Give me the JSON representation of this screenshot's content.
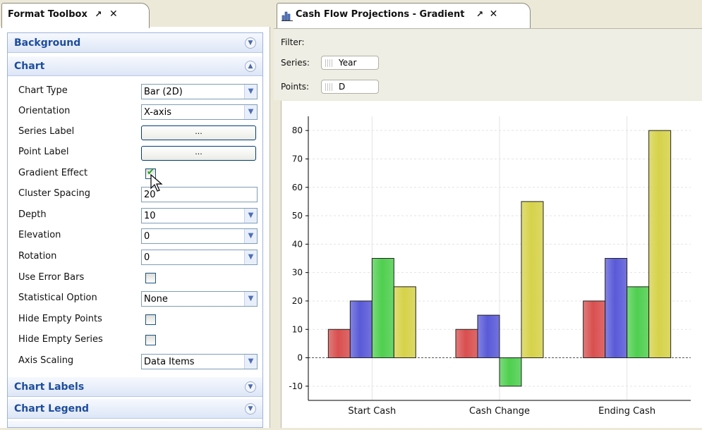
{
  "toolbox": {
    "tab_title": "Format Toolbox",
    "sections": {
      "background": "Background",
      "chart": "Chart",
      "chart_labels": "Chart Labels",
      "chart_legend": "Chart Legend"
    },
    "props": {
      "chart_type": {
        "label": "Chart Type",
        "value": "Bar (2D)"
      },
      "orientation": {
        "label": "Orientation",
        "value": "X-axis"
      },
      "series_label": {
        "label": "Series Label",
        "button": "..."
      },
      "point_label": {
        "label": "Point Label",
        "button": "..."
      },
      "gradient_effect": {
        "label": "Gradient Effect",
        "checked": true
      },
      "cluster_spacing": {
        "label": "Cluster Spacing",
        "value": "20"
      },
      "depth": {
        "label": "Depth",
        "value": "10"
      },
      "elevation": {
        "label": "Elevation",
        "value": "0"
      },
      "rotation": {
        "label": "Rotation",
        "value": "0"
      },
      "use_error_bars": {
        "label": "Use Error Bars",
        "checked": false
      },
      "statistical_option": {
        "label": "Statistical Option",
        "value": "None"
      },
      "hide_empty_points": {
        "label": "Hide Empty Points",
        "checked": false
      },
      "hide_empty_series": {
        "label": "Hide Empty Series",
        "checked": false
      },
      "axis_scaling": {
        "label": "Axis Scaling",
        "value": "Data Items"
      }
    }
  },
  "chart_pane": {
    "tab_title": "Cash Flow Projections - Gradient",
    "filter_label": "Filter:",
    "series_label": "Series:",
    "series_value": "Year",
    "points_label": "Points:",
    "points_value": "D"
  },
  "chart_data": {
    "type": "bar",
    "categories": [
      "Start Cash",
      "Cash Change",
      "Ending Cash"
    ],
    "series": [
      {
        "color": "#d94f4f",
        "values": [
          10,
          10,
          20
        ]
      },
      {
        "color": "#5a5ad8",
        "values": [
          20,
          15,
          35
        ]
      },
      {
        "color": "#4fcf4f",
        "values": [
          35,
          -10,
          25
        ]
      },
      {
        "color": "#d6d24a",
        "values": [
          25,
          55,
          80
        ]
      }
    ],
    "ylim": [
      -15,
      85
    ],
    "yticks": [
      -10,
      0,
      10,
      20,
      30,
      40,
      50,
      60,
      70,
      80
    ],
    "grid": true
  }
}
